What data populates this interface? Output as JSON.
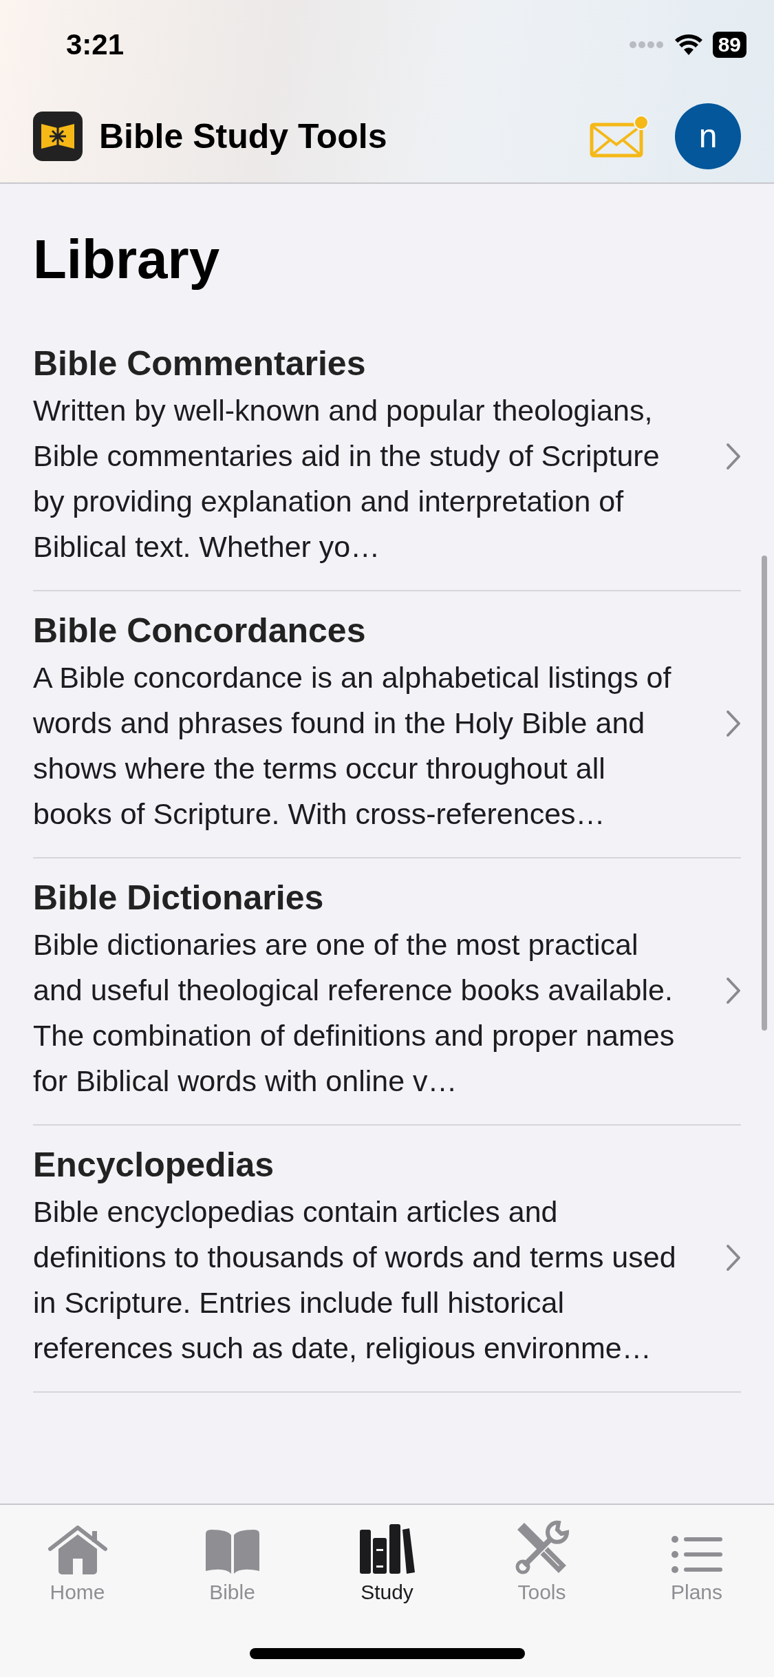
{
  "status_bar": {
    "time": "3:21",
    "battery": "89"
  },
  "header": {
    "app_name": "Bible Study Tools",
    "mail_unread": true,
    "avatar": "n"
  },
  "page_title": "Library",
  "items": [
    {
      "title": "Bible Commentaries",
      "description": "Written by well-known and popular theologians, Bible commentaries aid in the study of Scripture by providing explanation and interpretation of Biblical text. Whether yo…"
    },
    {
      "title": "Bible Concordances",
      "description": "A Bible concordance is an alphabetical listings of words and phrases found in the Holy Bible and shows where the terms occur throughout all books of Scripture. With cross-references…"
    },
    {
      "title": "Bible Dictionaries",
      "description": "Bible dictionaries are one of the most practical and useful theological reference books available. The combination of definitions and proper names for Biblical words with online v…"
    },
    {
      "title": "Encyclopedias",
      "description": "Bible encyclopedias contain articles and definitions to thousands of words and terms used in Scripture. Entries include full historical references such as date, religious environme…"
    }
  ],
  "tab_bar": [
    {
      "label": "Home",
      "kind": "home",
      "selected": false
    },
    {
      "label": "Bible",
      "kind": "bible",
      "selected": false
    },
    {
      "label": "Study",
      "kind": "study",
      "selected": true
    },
    {
      "label": "Tools",
      "kind": "tools",
      "selected": false
    },
    {
      "label": "Plans",
      "kind": "plans",
      "selected": false
    }
  ]
}
